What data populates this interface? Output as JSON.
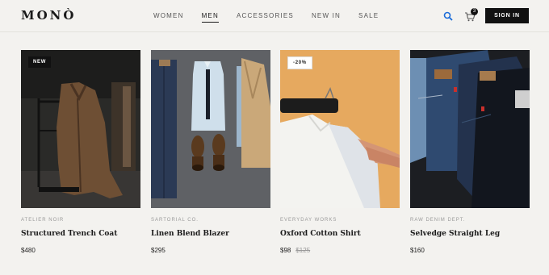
{
  "brand": {
    "logo": "MONÒ"
  },
  "nav": [
    "WOMEN",
    "MEN",
    "ACCESSORIES",
    "NEW IN",
    "SALE"
  ],
  "nav_active": "MEN",
  "cart": {
    "count": "3"
  },
  "signin_label": "SIGN IN",
  "products": [
    {
      "badge": "NEW",
      "brand": "ATELIER NOIR",
      "name": "Structured Trench Coat",
      "price": "$480",
      "old_price": ""
    },
    {
      "badge": "",
      "brand": "SARTORIAL CO.",
      "name": "Linen Blend Blazer",
      "price": "$295",
      "old_price": ""
    },
    {
      "badge": "-20%",
      "brand": "EVERYDAY WORKS",
      "name": "Oxford Cotton Shirt",
      "price": "$98",
      "old_price": "$125"
    },
    {
      "badge": "",
      "brand": "RAW DENIM DEPT.",
      "name": "Selvedge Straight Leg",
      "price": "$160",
      "old_price": ""
    }
  ],
  "icons": [
    "search-icon",
    "cart-icon"
  ],
  "colors": {
    "accent": "#111111",
    "background": "#f3f2ef"
  }
}
